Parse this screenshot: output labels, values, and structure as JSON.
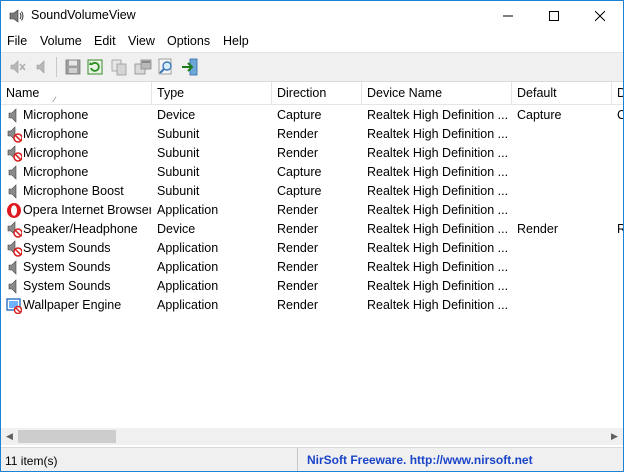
{
  "window": {
    "title": "SoundVolumeView"
  },
  "menu": [
    "File",
    "Volume",
    "Edit",
    "View",
    "Options",
    "Help"
  ],
  "toolbar": [
    "mute-speaker-icon",
    "speaker-icon",
    "save-icon",
    "refresh-icon",
    "copy-icon",
    "properties-icon",
    "find-icon",
    "exit-icon"
  ],
  "columns": [
    "Name",
    "Type",
    "Direction",
    "Device Name",
    "Default",
    "D"
  ],
  "rows": [
    {
      "name": "Microphone",
      "type": "Device",
      "direction": "Capture",
      "device": "Realtek High Definition ...",
      "default": "Capture",
      "extra": "C",
      "icon": "speaker"
    },
    {
      "name": "Microphone",
      "type": "Subunit",
      "direction": "Render",
      "device": "Realtek High Definition ...",
      "default": "",
      "extra": "",
      "icon": "muted"
    },
    {
      "name": "Microphone",
      "type": "Subunit",
      "direction": "Render",
      "device": "Realtek High Definition ...",
      "default": "",
      "extra": "",
      "icon": "muted"
    },
    {
      "name": "Microphone",
      "type": "Subunit",
      "direction": "Capture",
      "device": "Realtek High Definition ...",
      "default": "",
      "extra": "",
      "icon": "speaker"
    },
    {
      "name": "Microphone Boost",
      "type": "Subunit",
      "direction": "Capture",
      "device": "Realtek High Definition ...",
      "default": "",
      "extra": "",
      "icon": "speaker"
    },
    {
      "name": "Opera Internet Browser",
      "type": "Application",
      "direction": "Render",
      "device": "Realtek High Definition ...",
      "default": "",
      "extra": "",
      "icon": "opera"
    },
    {
      "name": "Speaker/Headphone",
      "type": "Device",
      "direction": "Render",
      "device": "Realtek High Definition ...",
      "default": "Render",
      "extra": "R",
      "icon": "muted"
    },
    {
      "name": "System Sounds",
      "type": "Application",
      "direction": "Render",
      "device": "Realtek High Definition ...",
      "default": "",
      "extra": "",
      "icon": "muted"
    },
    {
      "name": "System Sounds",
      "type": "Application",
      "direction": "Render",
      "device": "Realtek High Definition ...",
      "default": "",
      "extra": "",
      "icon": "speaker"
    },
    {
      "name": "System Sounds",
      "type": "Application",
      "direction": "Render",
      "device": "Realtek High Definition ...",
      "default": "",
      "extra": "",
      "icon": "speaker"
    },
    {
      "name": "Wallpaper Engine",
      "type": "Application",
      "direction": "Render",
      "device": "Realtek High Definition ...",
      "default": "",
      "extra": "",
      "icon": "wallpaper"
    }
  ],
  "status": {
    "count": "11 item(s)",
    "link": "NirSoft Freeware.  http://www.nirsoft.net"
  },
  "colors": {
    "accent": "#1883d7",
    "link": "#1a45c8",
    "opera": "#e0191f",
    "mute": "#d81e1e"
  }
}
